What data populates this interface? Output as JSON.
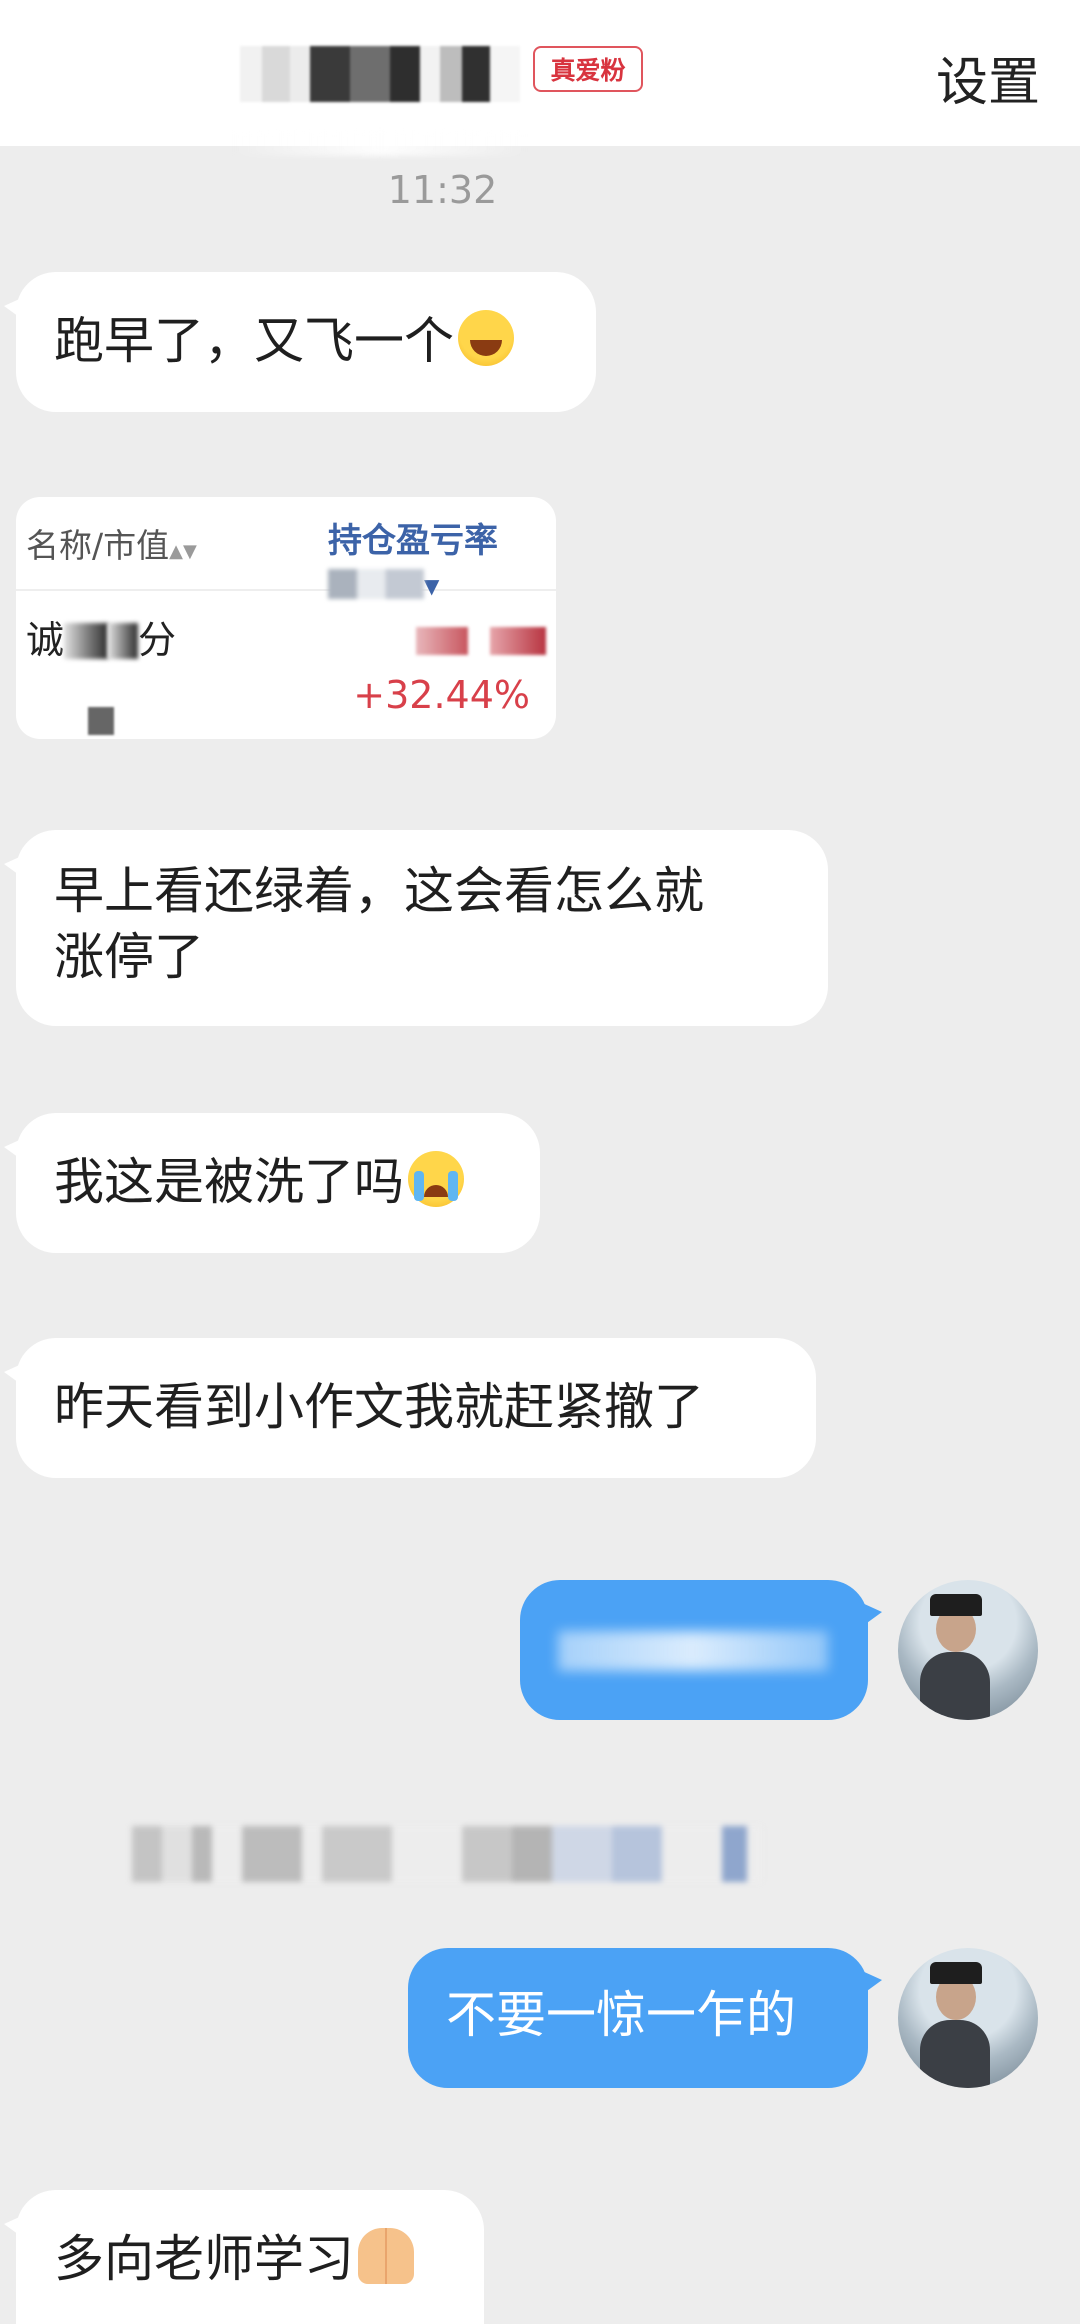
{
  "header": {
    "badge": "真爱粉",
    "settings": "设置"
  },
  "timestamp": "11:32",
  "messages": [
    {
      "text": "跑早了，又飞一个",
      "emoji": "laugh-cry-emoji"
    },
    {
      "text_line1": "早上看还绿着，这会看怎么就",
      "text_line2": "涨停了"
    },
    {
      "text": "我这是被洗了吗",
      "emoji": "crying-emoji"
    },
    {
      "text": "昨天看到小作文我就赶紧撤了"
    },
    {
      "text": "不要一惊一乍的"
    },
    {
      "text": "多向老师学习",
      "emoji": "praying-hands-emoji"
    }
  ],
  "stock_card": {
    "col_name": "名称/市值",
    "col_profit_prefix": "持仓盈亏率",
    "stock_name_prefix": "诚",
    "stock_name_suffix": "分",
    "change": "+32.44%",
    "colors": {
      "up": "#d8404a",
      "header_blue": "#3c63a8"
    }
  },
  "colors": {
    "bubble_out": "#4ba2f5",
    "bubble_in": "#ffffff",
    "background": "#ededed"
  }
}
